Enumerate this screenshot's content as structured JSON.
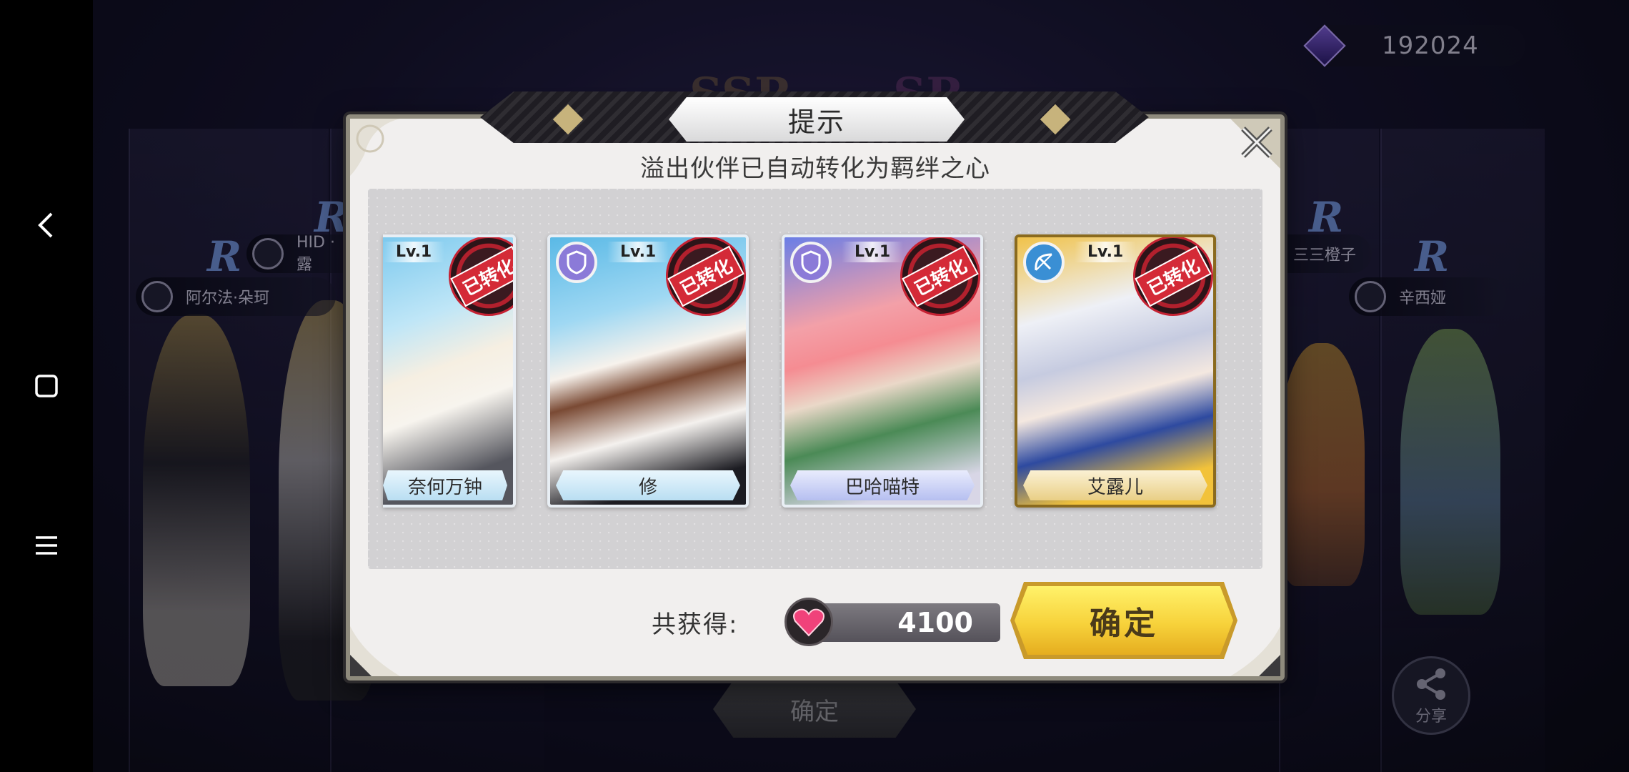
{
  "currency": {
    "value": "192024",
    "icon": "purple-gem-icon"
  },
  "background": {
    "tags": [
      {
        "label": "阿尔法·朵珂"
      },
      {
        "label": "HID · 露"
      },
      {
        "label": "三三橙子"
      },
      {
        "label": "辛西娅"
      }
    ],
    "rarity": {
      "r": "R",
      "ssr": "SSR",
      "sr": "SR"
    },
    "confirm_label": "确定",
    "share_label": "分享"
  },
  "dialog": {
    "title": "提示",
    "subtitle": "溢出伙伴已自动转化为羁绊之心",
    "cards": [
      {
        "name": "奈何万钟",
        "level": "Lv.1",
        "stamp": "已转化",
        "frame": "blue",
        "class_icon": ""
      },
      {
        "name": "修",
        "level": "Lv.1",
        "stamp": "已转化",
        "frame": "blue",
        "class_icon": "shield-icon"
      },
      {
        "name": "巴哈喵特",
        "level": "Lv.1",
        "stamp": "已转化",
        "frame": "purple",
        "class_icon": "shield-icon"
      },
      {
        "name": "艾露儿",
        "level": "Lv.1",
        "stamp": "已转化",
        "frame": "gold",
        "class_icon": "bow-icon"
      }
    ],
    "total_label": "共获得:",
    "total_value": "4100",
    "total_icon": "heart-icon",
    "confirm_label": "确定",
    "colors": {
      "confirm": "#f7d23b",
      "stamp": "#d42a37",
      "frame_border": "#8f8b7d"
    }
  }
}
